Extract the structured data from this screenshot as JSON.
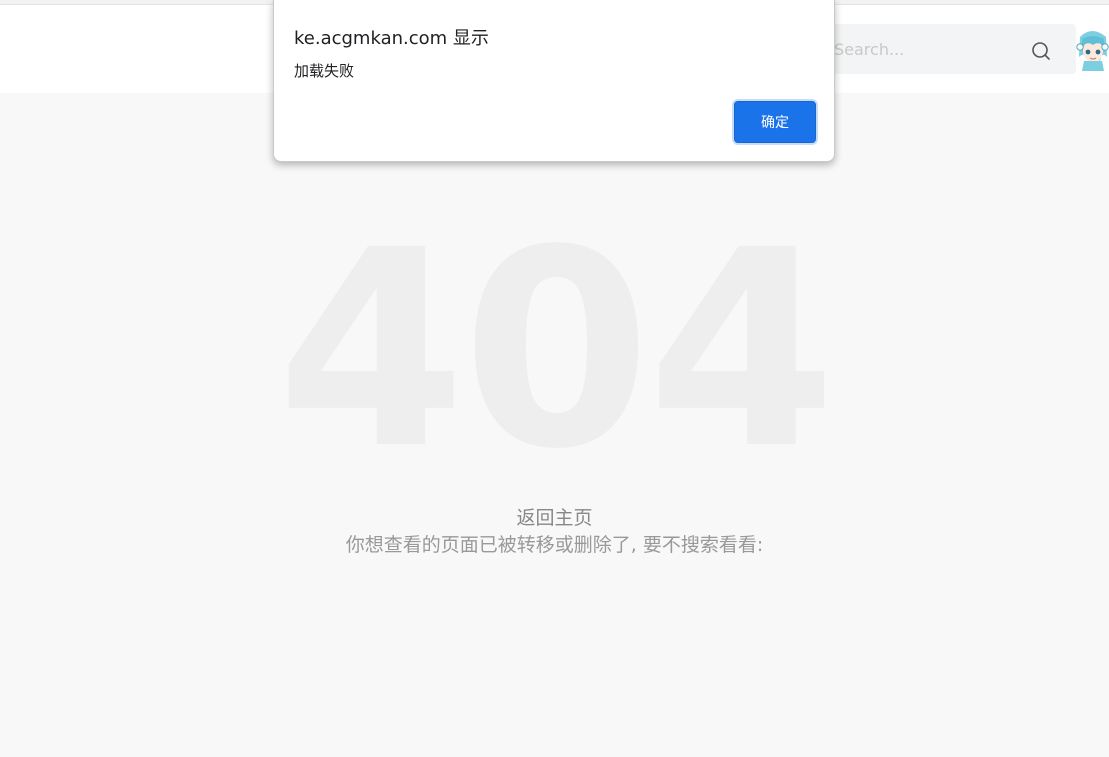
{
  "header": {
    "search": {
      "placeholder": "Search..."
    }
  },
  "main": {
    "error_code": "404",
    "home_link": "返回主页",
    "message": "你想查看的页面已被转移或删除了, 要不搜索看看:"
  },
  "dialog": {
    "title": "ke.acgmkan.com 显示",
    "message": "加载失败",
    "ok_label": "确定"
  },
  "colors": {
    "accent": "#1a73e8",
    "background": "#f8f8f8",
    "big_code": "#eeeeee"
  },
  "icons": [
    "search-icon",
    "avatar"
  ]
}
